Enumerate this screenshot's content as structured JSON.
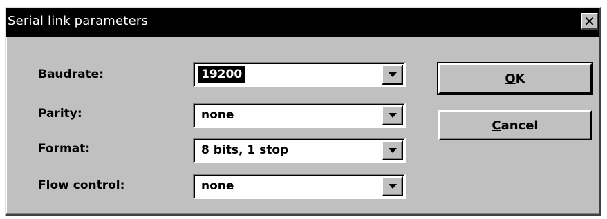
{
  "dialog": {
    "title": "Serial link parameters",
    "close_glyph": "✕"
  },
  "fields": [
    {
      "label": "Baudrate:",
      "value": "19200",
      "selected": true
    },
    {
      "label": "Parity:",
      "value": "none",
      "selected": false
    },
    {
      "label": "Format:",
      "value": "8 bits, 1 stop",
      "selected": false
    },
    {
      "label": "Flow control:",
      "value": "none",
      "selected": false
    }
  ],
  "buttons": {
    "ok": {
      "accel": "O",
      "rest": "K"
    },
    "cancel": {
      "accel": "C",
      "rest": "ancel"
    }
  },
  "icons": {
    "close": "close-icon",
    "dropdown": "chevron-down-icon"
  },
  "colors": {
    "titlebar": "#000000",
    "face": "#c0c0c0",
    "selection": "#000000"
  }
}
